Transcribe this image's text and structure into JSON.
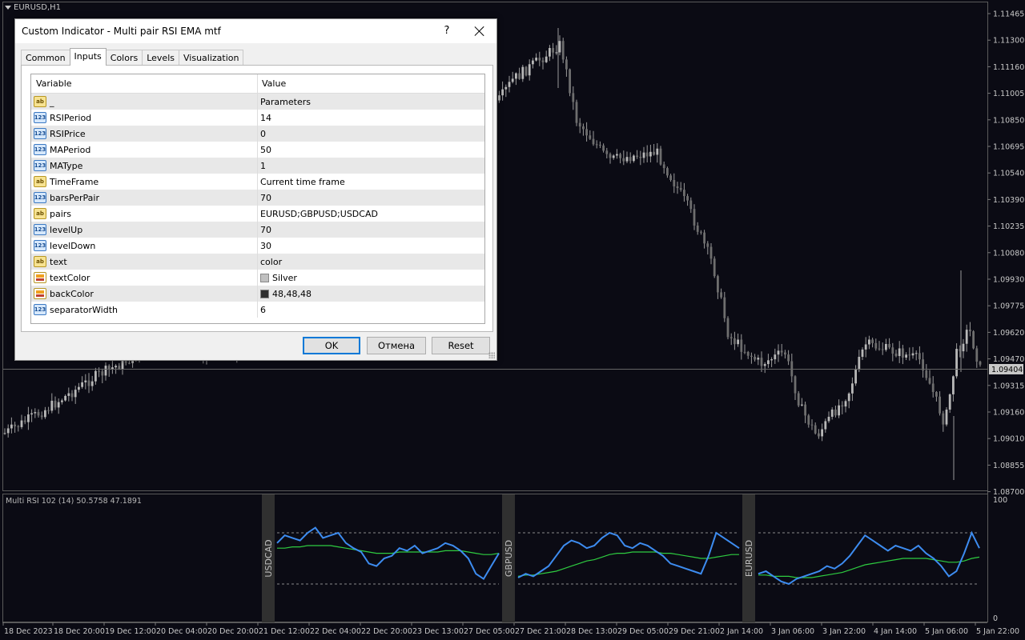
{
  "chart": {
    "symbol_label": "EURUSD,H1",
    "current_price": "1.09404",
    "price_ticks": [
      "1.11465",
      "1.11300",
      "1.11160",
      "1.11005",
      "1.10850",
      "1.10695",
      "1.10540",
      "1.10390",
      "1.10235",
      "1.10080",
      "1.09930",
      "1.09775",
      "1.09620",
      "1.09470",
      "1.09315",
      "1.09160",
      "1.09010",
      "1.08855",
      "1.08700"
    ],
    "time_ticks": [
      "18 Dec 2023",
      "18 Dec 20:00",
      "19 Dec 12:00",
      "20 Dec 04:00",
      "20 Dec 20:00",
      "21 Dec 12:00",
      "22 Dec 04:00",
      "22 Dec 20:00",
      "23 Dec 13:00",
      "27 Dec 05:00",
      "27 Dec 21:00",
      "28 Dec 13:00",
      "29 Dec 05:00",
      "29 Dec 21:00",
      "2 Jan 14:00",
      "3 Jan 06:00",
      "3 Jan 22:00",
      "4 Jan 14:00",
      "5 Jan 06:00",
      "5 Jan 22:00"
    ]
  },
  "indicator": {
    "subwindow_label": "Multi RSI 102 (14) 50.5758 47.1891",
    "scale_top": "100",
    "scale_bottom": "0",
    "pairs": [
      "USDCAD",
      "GBPUSD",
      "EURUSD"
    ],
    "rsi_color": "#3d8cf0",
    "ema_color": "#2ecc40",
    "level_up": 70,
    "level_down": 30
  },
  "dialog": {
    "title": "Custom Indicator - Multi pair RSI EMA mtf",
    "help_label": "?",
    "tabs": [
      "Common",
      "Inputs",
      "Colors",
      "Levels",
      "Visualization"
    ],
    "active_tab": "Inputs",
    "columns": {
      "variable": "Variable",
      "value": "Value"
    },
    "rows": [
      {
        "type": "str",
        "name": "_",
        "value": "Parameters"
      },
      {
        "type": "num",
        "name": "RSIPeriod",
        "value": "14"
      },
      {
        "type": "num",
        "name": "RSIPrice",
        "value": "0"
      },
      {
        "type": "num",
        "name": "MAPeriod",
        "value": "50"
      },
      {
        "type": "num",
        "name": "MAType",
        "value": "1"
      },
      {
        "type": "str",
        "name": "TimeFrame",
        "value": "Current time frame"
      },
      {
        "type": "num",
        "name": "barsPerPair",
        "value": "70"
      },
      {
        "type": "str",
        "name": "pairs",
        "value": "EURUSD;GBPUSD;USDCAD"
      },
      {
        "type": "num",
        "name": "levelUp",
        "value": "70"
      },
      {
        "type": "num",
        "name": "levelDown",
        "value": "30"
      },
      {
        "type": "str",
        "name": "text",
        "value": "color"
      },
      {
        "type": "col",
        "name": "textColor",
        "value": "Silver",
        "swatch": "#c0c0c0"
      },
      {
        "type": "col",
        "name": "backColor",
        "value": "48,48,48",
        "swatch": "#303030"
      },
      {
        "type": "num",
        "name": "separatorWidth",
        "value": "6"
      }
    ],
    "buttons": {
      "ok": "OK",
      "cancel": "Отмена",
      "reset": "Reset"
    }
  }
}
